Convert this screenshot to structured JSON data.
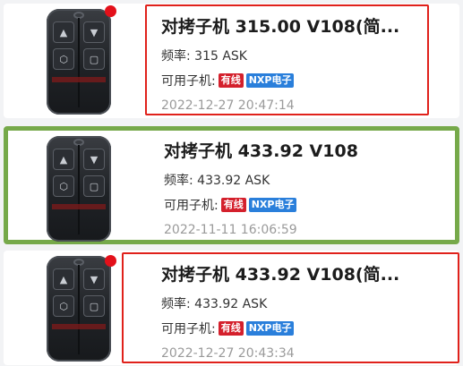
{
  "items": [
    {
      "title": "对拷子机 315.00 V108(简...",
      "freq_label": "频率: 315 ASK",
      "compat_label": "可用子机:",
      "tag_wired": "有线",
      "tag_nxp": "NXP电子",
      "timestamp": "2022-12-27 20:47:14",
      "has_red_dot": true,
      "selected": false
    },
    {
      "title": "对拷子机 433.92 V108",
      "freq_label": "频率: 433.92 ASK",
      "compat_label": "可用子机:",
      "tag_wired": "有线",
      "tag_nxp": "NXP电子",
      "timestamp": "2022-11-11 16:06:59",
      "has_red_dot": false,
      "selected": true
    },
    {
      "title": "对拷子机 433.92 V108(简...",
      "freq_label": "频率: 433.92 ASK",
      "compat_label": "可用子机:",
      "tag_wired": "有线",
      "tag_nxp": "NXP电子",
      "timestamp": "2022-12-27 20:43:34",
      "has_red_dot": true,
      "selected": false
    }
  ],
  "icons": {
    "unlock": "🔓",
    "lock": "🔒",
    "trunk": "▢",
    "colors": {
      "selected_border": "#76a94a",
      "outline_red": "#e0211b",
      "dot": "#e3101a"
    }
  }
}
